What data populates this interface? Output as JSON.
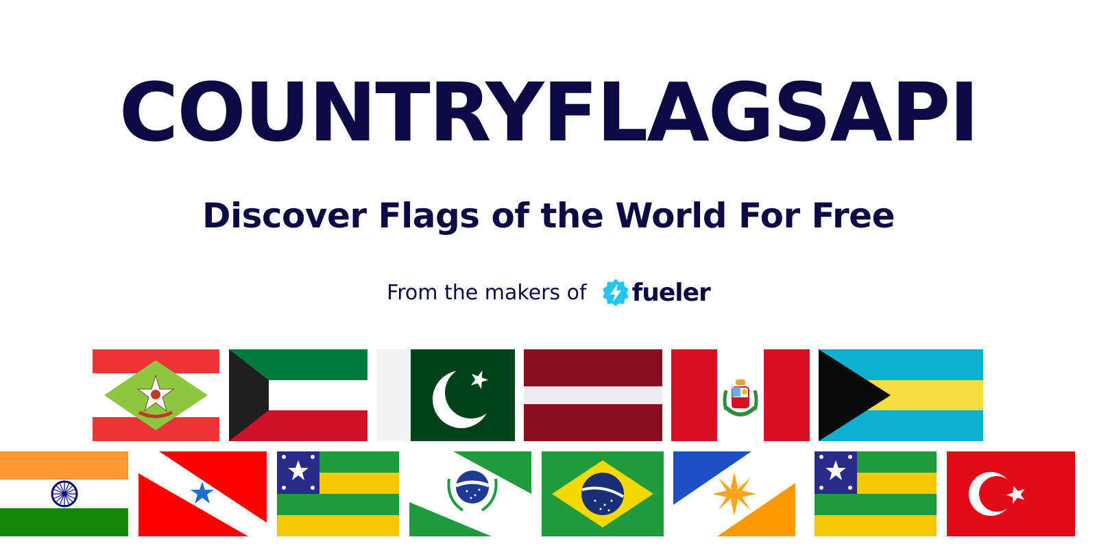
{
  "hero": {
    "title": "COUNTRYFLAGSAPI",
    "subtitle": "Discover Flags of the World For Free",
    "makers_text": "From the makers of",
    "brand_name": "fueler"
  },
  "colors": {
    "navy": "#0b0a45",
    "brand_accent": "#22c6f0",
    "background": "#ffffff"
  },
  "flags": {
    "row1": [
      "santa-catarina",
      "kuwait",
      "pakistan",
      "latvia",
      "peru",
      "bahamas"
    ],
    "row2": [
      "india",
      "para",
      "sergipe",
      "parana",
      "brazil",
      "tocantins",
      "sergipe",
      "turkey"
    ]
  }
}
